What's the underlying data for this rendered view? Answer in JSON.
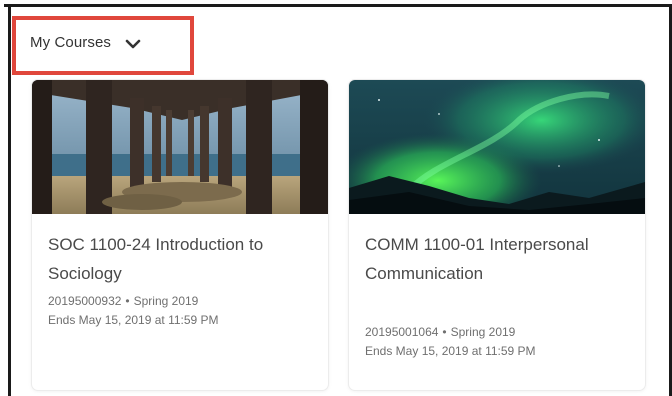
{
  "header": {
    "my_courses_label": "My Courses",
    "highlight_color": "#e0473c"
  },
  "courses": [
    {
      "title": "SOC 1100-24 Introduction to Sociology",
      "code": "20195000932",
      "term": "Spring 2019",
      "separator": "•",
      "ends": "Ends May 15, 2019 at 11:59 PM",
      "image": "pier-pilings-photo"
    },
    {
      "title": "COMM 1100-01 Interpersonal Communication",
      "code": "20195001064",
      "term": "Spring 2019",
      "separator": "•",
      "ends": "Ends May 15, 2019 at 11:59 PM",
      "image": "northern-lights-photo"
    }
  ],
  "icons": {
    "dropdown": "chevron-down-icon"
  }
}
